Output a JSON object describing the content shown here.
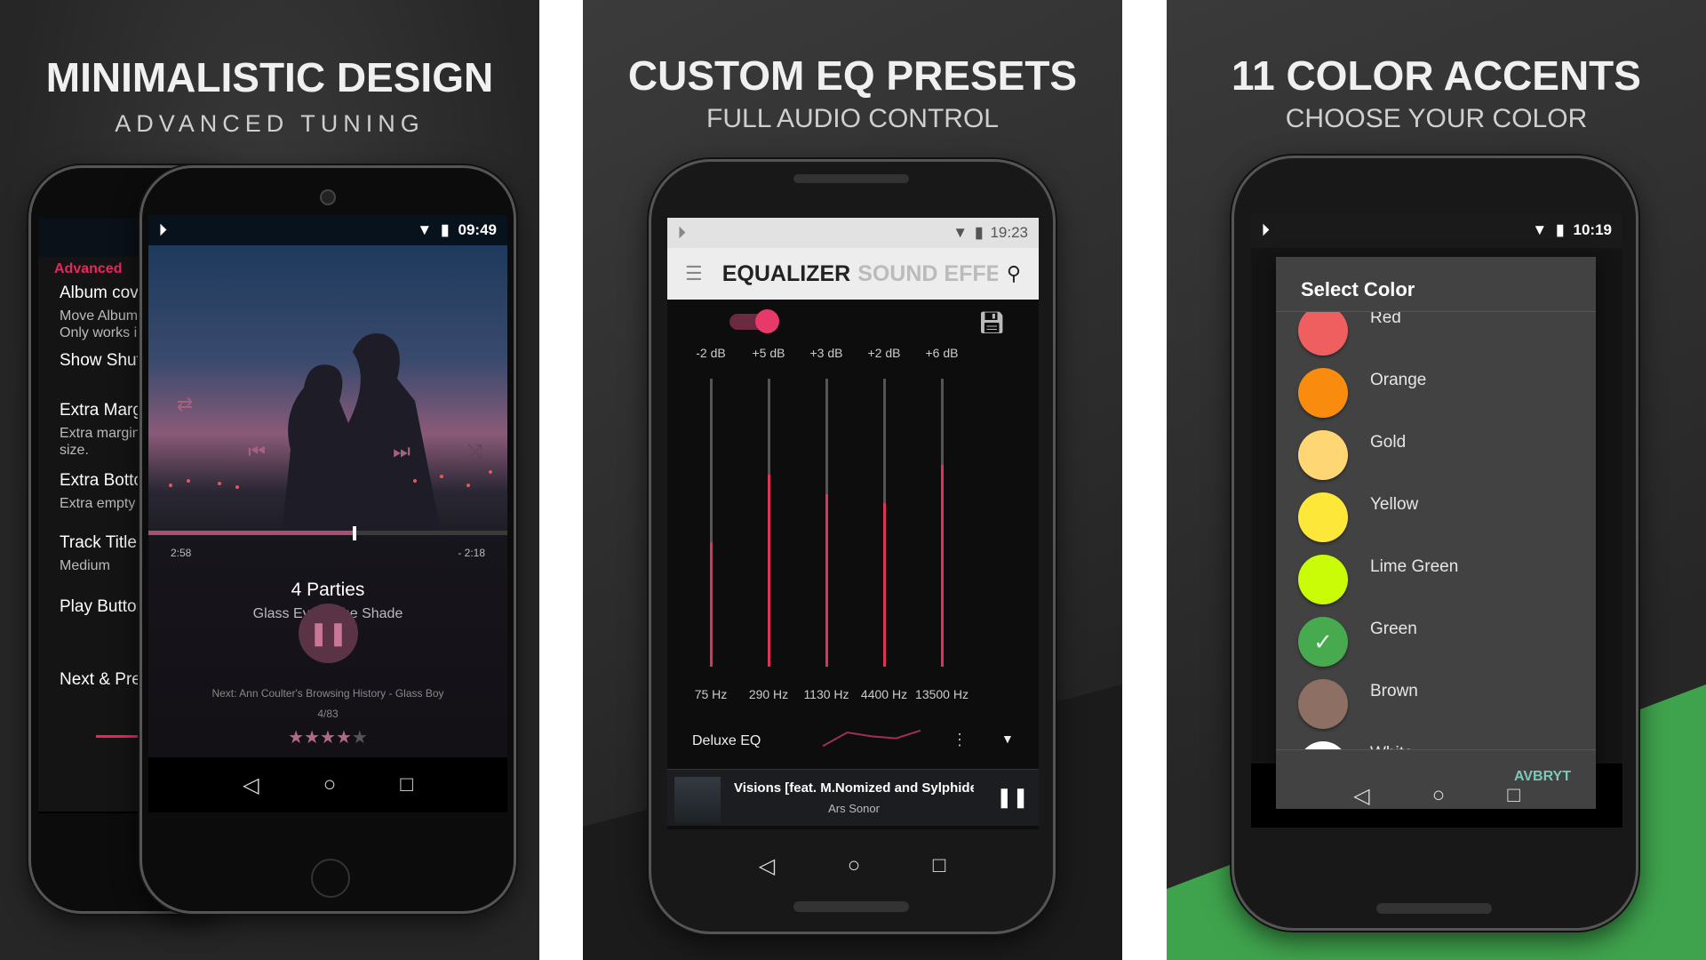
{
  "panels": [
    {
      "title": "MINIMALISTIC DESIGN",
      "subtitle": "ADVANCED TUNING"
    },
    {
      "title": "CUSTOM EQ PRESETS",
      "subtitle": "FULL AUDIO CONTROL"
    },
    {
      "title": "11 COLOR ACCENTS",
      "subtitle": "CHOOSE YOUR COLOR"
    }
  ],
  "settings": {
    "section": "Advanced",
    "items": [
      {
        "title": "Album cover",
        "sub": "Move Album c\nOnly works in"
      },
      {
        "title": "Show Shuffle",
        "sub": ""
      },
      {
        "title": "Extra Margin",
        "sub": "Extra margin a\nsize."
      },
      {
        "title": "Extra Bottom",
        "sub": "Extra empty sp"
      },
      {
        "title": "Track Title &",
        "sub": "Medium"
      },
      {
        "title": "Play Button S",
        "sub": ""
      },
      {
        "title": "Next & Previ",
        "sub": ""
      }
    ]
  },
  "player": {
    "time": "09:49",
    "elapsed": "2:58",
    "remaining": "- 2:18",
    "progress": 0.57,
    "title": "4 Parties",
    "artist": "Glass Eye – The Shade",
    "next": "Next: Ann Coulter's Browsing History - Glass Boy",
    "queue": "4/83",
    "rating": 4,
    "rating_max": 5,
    "accent": "#a8607c"
  },
  "equalizer": {
    "time": "19:23",
    "title": "EQUALIZER",
    "title_faded": "SOUND EFFE",
    "enabled": true,
    "accent": "#e0325a",
    "bands": [
      {
        "gain": "-2 dB",
        "value": -2,
        "freq": "75 Hz"
      },
      {
        "gain": "+5 dB",
        "value": 5,
        "freq": "290 Hz"
      },
      {
        "gain": "+3 dB",
        "value": 3,
        "freq": "1130 Hz"
      },
      {
        "gain": "+2 dB",
        "value": 2,
        "freq": "4400 Hz"
      },
      {
        "gain": "+6 dB",
        "value": 6,
        "freq": "13500 Hz"
      }
    ],
    "preset": "Deluxe EQ",
    "now_playing": {
      "title": "Visions [feat. M.Nomized and Sylphides",
      "artist": "Ars Sonor"
    }
  },
  "colors": {
    "time": "10:19",
    "dialog_title": "Select Color",
    "cancel": "AVBRYT",
    "selected": "Green",
    "items": [
      {
        "name": "Red",
        "hex": "#ef5f5f"
      },
      {
        "name": "Orange",
        "hex": "#f98c0f"
      },
      {
        "name": "Gold",
        "hex": "#fed673"
      },
      {
        "name": "Yellow",
        "hex": "#fde83a"
      },
      {
        "name": "Lime Green",
        "hex": "#c9fc06"
      },
      {
        "name": "Green",
        "hex": "#47aa4f"
      },
      {
        "name": "Brown",
        "hex": "#8e6f63"
      },
      {
        "name": "White",
        "hex": "#ffffff"
      }
    ]
  }
}
